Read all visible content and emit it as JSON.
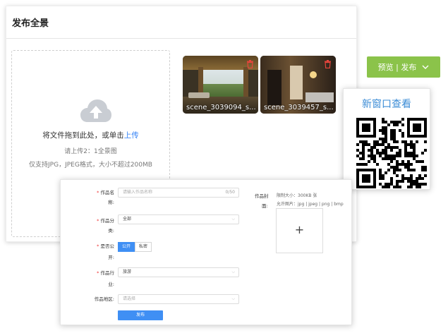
{
  "page": {
    "title": "发布全景"
  },
  "upload": {
    "instruction_prefix": "将文件拖到此处，或单击",
    "upload_link": "上传",
    "hint": "请上传2：1全景图",
    "formats": "仅支持JPG，JPEG格式，大小不超过200MB"
  },
  "thumbnails": [
    {
      "caption": "scene_3039094_s...",
      "delete_icon": "trash-icon"
    },
    {
      "caption": "scene_3039457_s...",
      "delete_icon": "trash-icon"
    }
  ],
  "preview_button": {
    "label": "预览 | 发布",
    "icon": "chevron-down-icon"
  },
  "qr_popup": {
    "title": "新窗口查看"
  },
  "form": {
    "name_label_1": "作品名",
    "name_label_2": "称:",
    "name_placeholder": "请输入作品名称",
    "name_count": "0/50",
    "category_label_1": "作品分",
    "category_label_2": "类:",
    "category_value": "全部",
    "public_label_1": "是否公",
    "public_label_2": "开:",
    "public_options": [
      "公开",
      "私密"
    ],
    "industry_label_1": "作品行",
    "industry_label_2": "业:",
    "industry_value": "旅游",
    "region_label": "作品地区:",
    "region_placeholder": "请选择",
    "submit_label": "发布",
    "cover_label_1": "作品封",
    "cover_label_2": "面:",
    "cover_size": "限制大小：300KB 张",
    "cover_formats": "允许图片：jpg | jpeg | png | bmp",
    "cover_add": "+"
  },
  "colors": {
    "accent_blue": "#3f8ff4",
    "link_blue": "#2d7ef5",
    "preview_green": "#8bc34a",
    "qr_title_blue": "#3b8cd6"
  }
}
